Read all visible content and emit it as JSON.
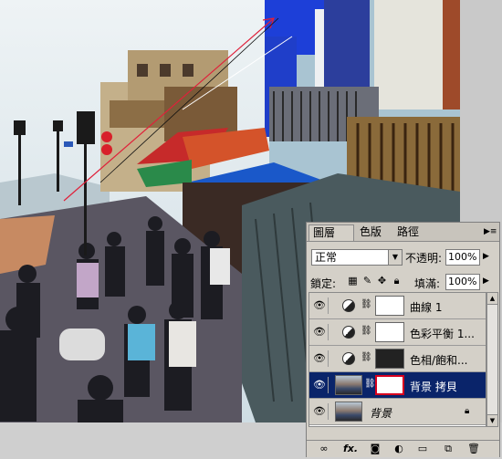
{
  "panel": {
    "tabs": [
      {
        "label": "圖層",
        "active": true
      },
      {
        "label": "色版",
        "active": false
      },
      {
        "label": "路徑",
        "active": false
      }
    ],
    "menu_icon": "panel-menu-icon",
    "blend_mode": "正常",
    "opacity_label": "不透明:",
    "opacity_value": "100%",
    "lock_label": "鎖定:",
    "fill_label": "填滿:",
    "fill_value": "100%",
    "layers": [
      {
        "name": "曲線 1",
        "type": "adjustment"
      },
      {
        "name": "色彩平衡 1...",
        "type": "adjustment"
      },
      {
        "name": "色相/飽和...",
        "type": "adjustment"
      },
      {
        "name": "背景 拷貝",
        "type": "pixel-with-mask",
        "selected": true
      },
      {
        "name": "背景",
        "type": "background",
        "locked": true
      }
    ],
    "footer_icons": [
      "link-icon",
      "fx-icon",
      "mask-icon",
      "adjustment-icon",
      "group-icon",
      "new-layer-icon",
      "trash-icon"
    ],
    "footer_labels": {
      "link": "∞",
      "fx": "fx."
    }
  },
  "colors": {
    "panel_bg": "#d4d0c8",
    "selection": "#0a246a",
    "mask_highlight": "#d8001e",
    "arrow": "#e0203a"
  }
}
